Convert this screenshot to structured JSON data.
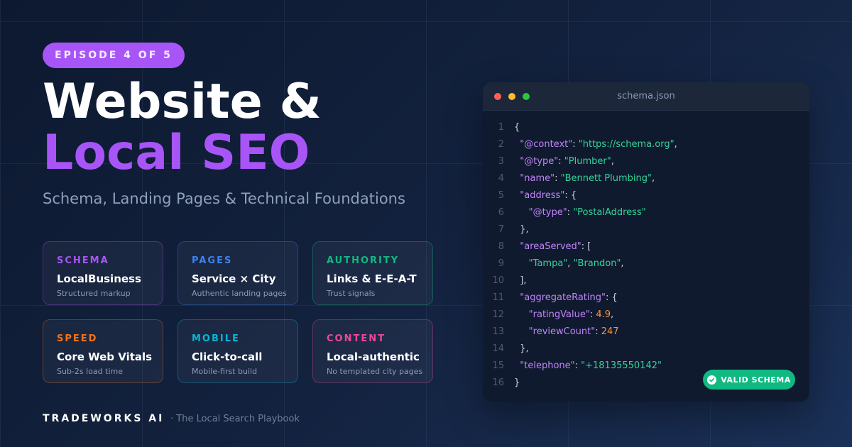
{
  "badge": "EPISODE 4 OF 5",
  "title": {
    "line1": "Website &",
    "line2": "Local SEO"
  },
  "subtitle": "Schema, Landing Pages & Technical Foundations",
  "cards": [
    {
      "category": "SCHEMA",
      "heading": "LocalBusiness",
      "desc": "Structured markup",
      "color": "#a855f7"
    },
    {
      "category": "PAGES",
      "heading": "Service × City",
      "desc": "Authentic landing pages",
      "color": "#3b82f6"
    },
    {
      "category": "AUTHORITY",
      "heading": "Links & E-E-A-T",
      "desc": "Trust signals",
      "color": "#10b981"
    },
    {
      "category": "SPEED",
      "heading": "Core Web Vitals",
      "desc": "Sub-2s load time",
      "color": "#f97316"
    },
    {
      "category": "MOBILE",
      "heading": "Click-to-call",
      "desc": "Mobile-first build",
      "color": "#06b6d4"
    },
    {
      "category": "CONTENT",
      "heading": "Local-authentic",
      "desc": "No templated city pages",
      "color": "#ec4899"
    }
  ],
  "footer": {
    "brand": "TRADEWORKS AI",
    "tagline": "· The Local Search Playbook"
  },
  "editor": {
    "filename": "schema.json",
    "window_dots": [
      "#ff5f57",
      "#febc2e",
      "#28c840"
    ],
    "lines": [
      {
        "num": "1",
        "tokens": [
          [
            "p",
            "{"
          ]
        ]
      },
      {
        "num": "2",
        "tokens": [
          [
            "p",
            "  "
          ],
          [
            "k",
            "\"@context\""
          ],
          [
            "p",
            ": "
          ],
          [
            "s",
            "\"https://schema.org\""
          ],
          [
            "p",
            ","
          ]
        ]
      },
      {
        "num": "3",
        "tokens": [
          [
            "p",
            "  "
          ],
          [
            "k",
            "\"@type\""
          ],
          [
            "p",
            ": "
          ],
          [
            "s",
            "\"Plumber\""
          ],
          [
            "p",
            ","
          ]
        ]
      },
      {
        "num": "4",
        "tokens": [
          [
            "p",
            "  "
          ],
          [
            "k",
            "\"name\""
          ],
          [
            "p",
            ": "
          ],
          [
            "s",
            "\"Bennett Plumbing\""
          ],
          [
            "p",
            ","
          ]
        ]
      },
      {
        "num": "5",
        "tokens": [
          [
            "p",
            "  "
          ],
          [
            "k",
            "\"address\""
          ],
          [
            "p",
            ": {"
          ]
        ]
      },
      {
        "num": "6",
        "tokens": [
          [
            "p",
            "     "
          ],
          [
            "k",
            "\"@type\""
          ],
          [
            "p",
            ": "
          ],
          [
            "s",
            "\"PostalAddress\""
          ]
        ]
      },
      {
        "num": "7",
        "tokens": [
          [
            "p",
            "  },"
          ]
        ]
      },
      {
        "num": "8",
        "tokens": [
          [
            "p",
            "  "
          ],
          [
            "k",
            "\"areaServed\""
          ],
          [
            "p",
            ": ["
          ]
        ]
      },
      {
        "num": "9",
        "tokens": [
          [
            "p",
            "     "
          ],
          [
            "s",
            "\"Tampa\""
          ],
          [
            "p",
            ", "
          ],
          [
            "s",
            "\"Brandon\""
          ],
          [
            "p",
            ","
          ]
        ]
      },
      {
        "num": "10",
        "tokens": [
          [
            "p",
            "  ],"
          ]
        ]
      },
      {
        "num": "11",
        "tokens": [
          [
            "p",
            "  "
          ],
          [
            "k",
            "\"aggregateRating\""
          ],
          [
            "p",
            ": {"
          ]
        ]
      },
      {
        "num": "12",
        "tokens": [
          [
            "p",
            "     "
          ],
          [
            "k",
            "\"ratingValue\""
          ],
          [
            "p",
            ": "
          ],
          [
            "n",
            "4.9"
          ],
          [
            "p",
            ","
          ]
        ]
      },
      {
        "num": "13",
        "tokens": [
          [
            "p",
            "     "
          ],
          [
            "k",
            "\"reviewCount\""
          ],
          [
            "p",
            ": "
          ],
          [
            "n",
            "247"
          ]
        ]
      },
      {
        "num": "14",
        "tokens": [
          [
            "p",
            "  },"
          ]
        ]
      },
      {
        "num": "15",
        "tokens": [
          [
            "p",
            "  "
          ],
          [
            "k",
            "\"telephone\""
          ],
          [
            "p",
            ": "
          ],
          [
            "s",
            "\"+18135550142\""
          ]
        ]
      },
      {
        "num": "16",
        "tokens": [
          [
            "p",
            "}"
          ]
        ]
      }
    ],
    "valid_label": "VALID SCHEMA"
  }
}
